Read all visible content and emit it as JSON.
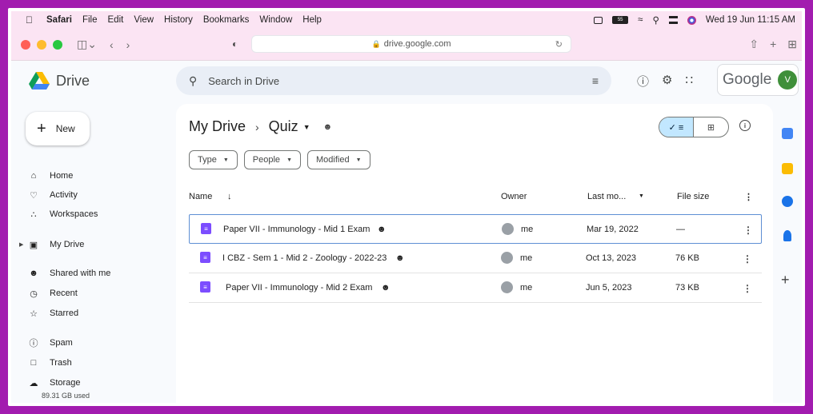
{
  "menubar": {
    "apple": "",
    "items": [
      "Safari",
      "File",
      "Edit",
      "View",
      "History",
      "Bookmarks",
      "Window",
      "Help"
    ],
    "datetime": "Wed 19 Jun 11:15 AM",
    "battery": "55"
  },
  "browser": {
    "url": "drive.google.com"
  },
  "drive": {
    "app_name": "Drive",
    "search_placeholder": "Search in Drive",
    "brand": "Google",
    "avatar_letter": "V"
  },
  "sidebar": {
    "new_label": "New",
    "items": [
      {
        "label": "Home",
        "icon": "home-icon"
      },
      {
        "label": "Activity",
        "icon": "bell-icon"
      },
      {
        "label": "Workspaces",
        "icon": "workspaces-icon"
      },
      {
        "label": "My Drive",
        "icon": "drive-icon"
      },
      {
        "label": "Shared with me",
        "icon": "shared-icon"
      },
      {
        "label": "Recent",
        "icon": "clock-icon"
      },
      {
        "label": "Starred",
        "icon": "star-icon"
      },
      {
        "label": "Spam",
        "icon": "spam-icon"
      },
      {
        "label": "Trash",
        "icon": "trash-icon"
      },
      {
        "label": "Storage",
        "icon": "cloud-icon"
      }
    ],
    "storage_used": "89.31 GB used"
  },
  "breadcrumb": {
    "root": "My Drive",
    "current": "Quiz"
  },
  "filters": [
    "Type",
    "People",
    "Modified"
  ],
  "table": {
    "headers": {
      "name": "Name",
      "owner": "Owner",
      "modified": "Last mo...",
      "size": "File size"
    },
    "rows": [
      {
        "name": "Paper VII - Immunology - Mid 1 Exam",
        "owner": "me",
        "modified": "Mar 19, 2022",
        "size": "—"
      },
      {
        "name": "I CBZ - Sem 1 - Mid 2 - Zoology - 2022-23",
        "owner": "me",
        "modified": "Oct 13, 2023",
        "size": "76 KB"
      },
      {
        "name": "Paper VII - Immunology - Mid 2 Exam",
        "owner": "me",
        "modified": "Jun 5, 2023",
        "size": "73 KB"
      }
    ]
  },
  "colors": {
    "frame": "#a21caf",
    "accent": "#c2e7ff",
    "form_icon": "#7c4dff"
  }
}
